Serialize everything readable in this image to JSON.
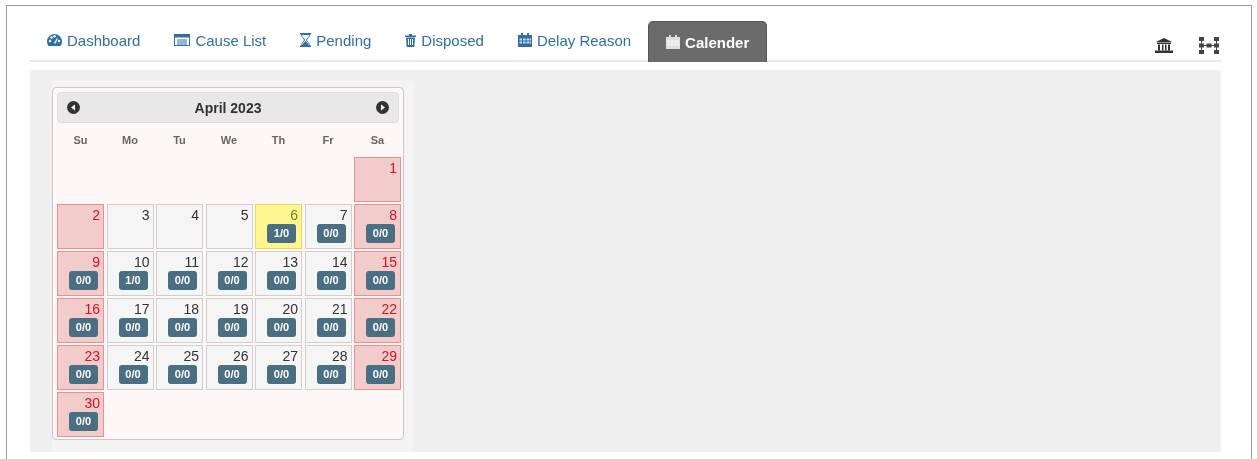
{
  "tabs": [
    {
      "label": "Dashboard",
      "kind": "gauge",
      "selected": false
    },
    {
      "label": "Cause List",
      "kind": "list",
      "selected": false
    },
    {
      "label": "Pending",
      "kind": "hourglass",
      "selected": false
    },
    {
      "label": "Disposed",
      "kind": "trash",
      "selected": false
    },
    {
      "label": "Delay Reason",
      "kind": "calendar",
      "selected": false
    },
    {
      "label": "Calender",
      "kind": "calendar",
      "selected": true
    }
  ],
  "calendar": {
    "title": "April 2023",
    "weekdays": [
      "Su",
      "Mo",
      "Tu",
      "We",
      "Th",
      "Fr",
      "Sa"
    ],
    "weeks": [
      [
        {
          "kind": "blank"
        },
        {
          "kind": "blank"
        },
        {
          "kind": "blank"
        },
        {
          "kind": "blank"
        },
        {
          "kind": "blank"
        },
        {
          "kind": "blank"
        },
        {
          "kind": "holiday",
          "day": "1"
        }
      ],
      [
        {
          "kind": "holiday",
          "day": "2"
        },
        {
          "kind": "workday",
          "day": "3"
        },
        {
          "kind": "workday",
          "day": "4"
        },
        {
          "kind": "workday",
          "day": "5"
        },
        {
          "kind": "today",
          "day": "6",
          "count": "1/0"
        },
        {
          "kind": "workday",
          "day": "7",
          "count": "0/0"
        },
        {
          "kind": "holiday",
          "day": "8",
          "count": "0/0"
        }
      ],
      [
        {
          "kind": "holiday",
          "day": "9",
          "count": "0/0"
        },
        {
          "kind": "workday",
          "day": "10",
          "count": "1/0"
        },
        {
          "kind": "workday",
          "day": "11",
          "count": "0/0"
        },
        {
          "kind": "workday",
          "day": "12",
          "count": "0/0"
        },
        {
          "kind": "workday",
          "day": "13",
          "count": "0/0"
        },
        {
          "kind": "workday",
          "day": "14",
          "count": "0/0"
        },
        {
          "kind": "holiday",
          "day": "15",
          "count": "0/0"
        }
      ],
      [
        {
          "kind": "holiday",
          "day": "16",
          "count": "0/0"
        },
        {
          "kind": "workday",
          "day": "17",
          "count": "0/0"
        },
        {
          "kind": "workday",
          "day": "18",
          "count": "0/0"
        },
        {
          "kind": "workday",
          "day": "19",
          "count": "0/0"
        },
        {
          "kind": "workday",
          "day": "20",
          "count": "0/0"
        },
        {
          "kind": "workday",
          "day": "21",
          "count": "0/0"
        },
        {
          "kind": "holiday",
          "day": "22",
          "count": "0/0"
        }
      ],
      [
        {
          "kind": "holiday",
          "day": "23",
          "count": "0/0"
        },
        {
          "kind": "workday",
          "day": "24",
          "count": "0/0"
        },
        {
          "kind": "workday",
          "day": "25",
          "count": "0/0"
        },
        {
          "kind": "workday",
          "day": "26",
          "count": "0/0"
        },
        {
          "kind": "workday",
          "day": "27",
          "count": "0/0"
        },
        {
          "kind": "workday",
          "day": "28",
          "count": "0/0"
        },
        {
          "kind": "holiday",
          "day": "29",
          "count": "0/0"
        }
      ],
      [
        {
          "kind": "holiday",
          "day": "30",
          "count": "0/0"
        }
      ]
    ]
  }
}
